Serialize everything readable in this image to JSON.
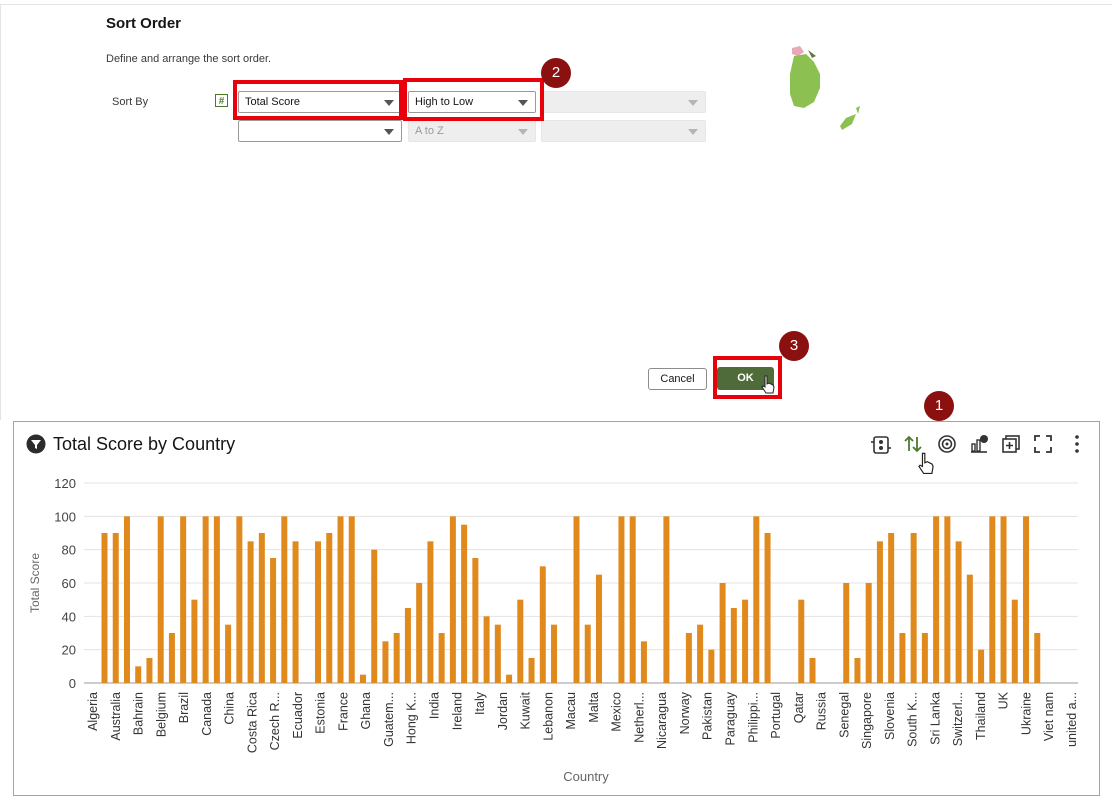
{
  "dialog": {
    "title": "Sort Order",
    "description": "Define and arrange the sort order.",
    "sort_by_label": "Sort By",
    "row1": {
      "column": "Total Score",
      "order": "High to Low",
      "third": ""
    },
    "row2": {
      "column": "",
      "order": "A to Z",
      "third": ""
    },
    "cancel_label": "Cancel",
    "ok_label": "OK"
  },
  "callouts": [
    "1",
    "2",
    "3"
  ],
  "chart_panel": {
    "title": "Total Score by Country",
    "toolbar_icons": [
      "data-actions-icon",
      "sort-icon",
      "target-icon",
      "chart-type-icon",
      "add-icon",
      "fullscreen-icon",
      "more-icon"
    ]
  },
  "colors": {
    "bar": "#e08a1e",
    "accent_green": "#4f6b3a",
    "highlight_red": "#e8000b",
    "step_badge": "#8b1010"
  },
  "chart_data": {
    "type": "bar",
    "xlabel": "Country",
    "ylabel": "Total Score",
    "ylim": [
      0,
      120
    ],
    "yticks": [
      0,
      20,
      40,
      60,
      80,
      100,
      120
    ],
    "grid": true,
    "tick_labels": [
      "Algeria",
      "Australia",
      "Bahrain",
      "Belgium",
      "Brazil",
      "Canada",
      "China",
      "Costa Rica",
      "Czech R...",
      "Ecuador",
      "Estonia",
      "France",
      "Ghana",
      "Guatem...",
      "Hong K...",
      "India",
      "Ireland",
      "Italy",
      "Jordan",
      "Kuwait",
      "Lebanon",
      "Macau",
      "Malta",
      "Mexico",
      "Netherl...",
      "Nicaragua",
      "Norway",
      "Pakistan",
      "Paraguay",
      "Philippi...",
      "Portugal",
      "Qatar",
      "Russia",
      "Senegal",
      "Singapore",
      "Slovenia",
      "South K...",
      "Sri Lanka",
      "Switzerl...",
      "Thailand",
      "UK",
      "Ukraine",
      "Viet nam",
      "united a..."
    ],
    "values": [
      90,
      90,
      100,
      10,
      15,
      100,
      30,
      100,
      50,
      100,
      100,
      35,
      100,
      85,
      90,
      75,
      100,
      85,
      0,
      85,
      90,
      100,
      100,
      5,
      80,
      25,
      30,
      45,
      60,
      85,
      30,
      100,
      95,
      75,
      40,
      35,
      5,
      50,
      15,
      70,
      35,
      0,
      100,
      35,
      65,
      0,
      100,
      100,
      25,
      0,
      100,
      0,
      30,
      35,
      20,
      60,
      45,
      50,
      100,
      90,
      0,
      0,
      50,
      15,
      0,
      0,
      60,
      15,
      60,
      85,
      90,
      30,
      90,
      30,
      100,
      100,
      85,
      65,
      20,
      100,
      100,
      50,
      100,
      30,
      0
    ]
  }
}
